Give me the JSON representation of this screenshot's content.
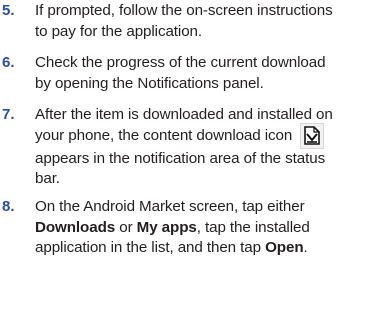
{
  "steps": [
    {
      "number": "5.",
      "lines": [
        "If prompted, follow the on-screen instructions",
        "to pay for the application."
      ]
    },
    {
      "number": "6.",
      "lines": [
        "Check the progress of the current download",
        "by opening the Notifications panel."
      ]
    },
    {
      "number": "7.",
      "lines": [
        "After the item is downloaded and installed on",
        "your phone, the content download icon",
        "appears in the notification area of the status",
        "bar."
      ]
    },
    {
      "number": "8.",
      "line1": "On the Android Market screen, tap either",
      "downloads": "Downloads",
      "or": " or ",
      "my_apps": "My apps",
      "line2_tail": ", tap the installed",
      "line3_head": "application in the list, and then tap ",
      "open": "Open",
      "period": "."
    }
  ],
  "icons": {
    "content_download": "download-complete-icon"
  }
}
